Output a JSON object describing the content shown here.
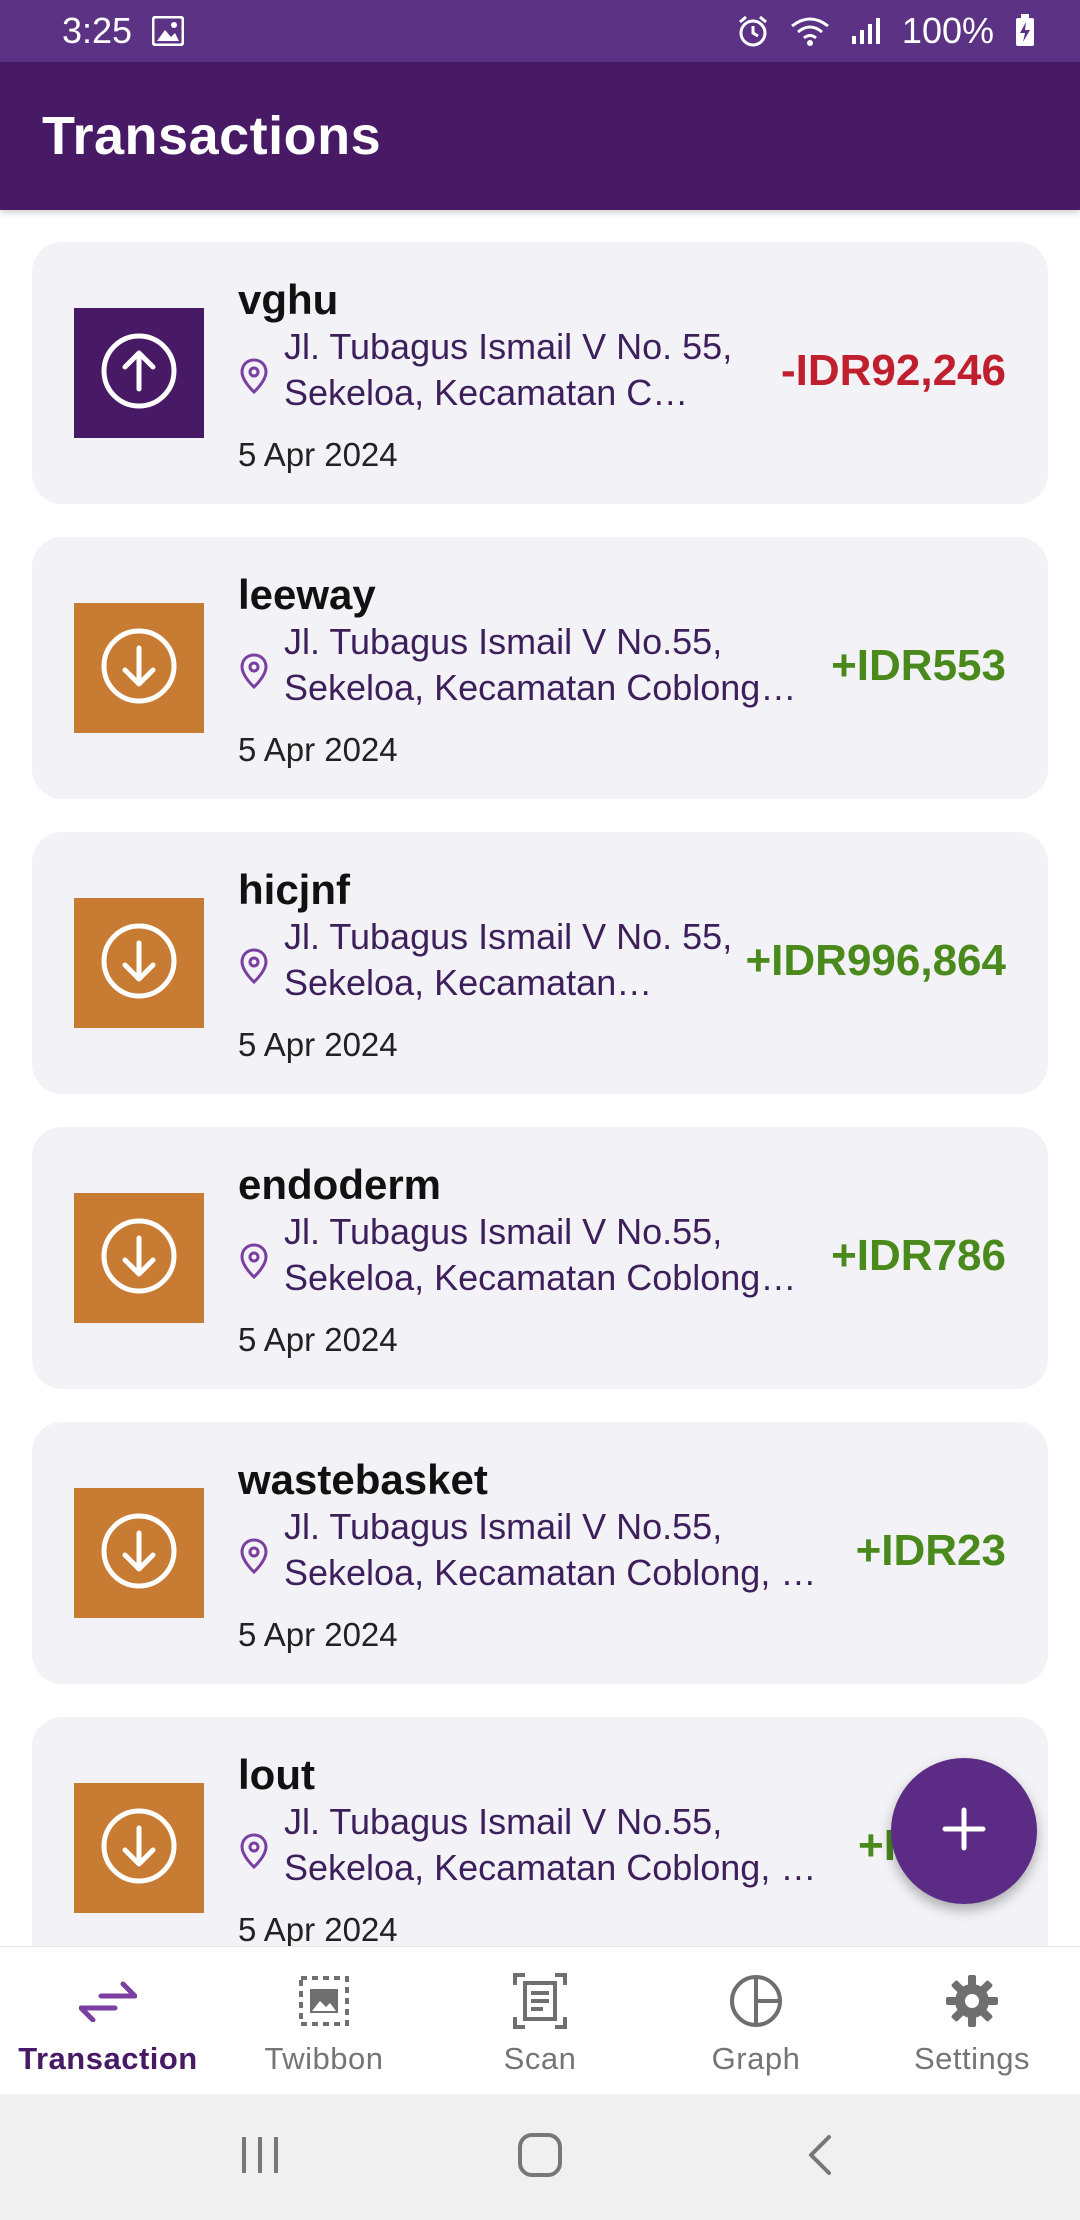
{
  "status_bar": {
    "time": "3:25",
    "battery": "100%"
  },
  "app_bar": {
    "title": "Transactions"
  },
  "transactions": [
    {
      "name": "vghu",
      "address": "Jl. Tubagus Ismail V No. 55, Sekeloa, Kecamatan C…",
      "date": "5 Apr 2024",
      "amount": "-IDR92,246",
      "type": "expense",
      "icon": "arrow-up-circle-icon"
    },
    {
      "name": "leeway",
      "address": "Jl. Tubagus Ismail V No.55, Sekeloa, Kecamatan Coblong…",
      "date": "5 Apr 2024",
      "amount": "+IDR553",
      "type": "income",
      "icon": "arrow-down-circle-icon"
    },
    {
      "name": "hicjnf",
      "address": "Jl. Tubagus Ismail V No. 55, Sekeloa, Kecamatan…",
      "date": "5 Apr 2024",
      "amount": "+IDR996,864",
      "type": "income",
      "icon": "arrow-down-circle-icon"
    },
    {
      "name": "endoderm",
      "address": "Jl. Tubagus Ismail V No.55, Sekeloa, Kecamatan Coblong…",
      "date": "5 Apr 2024",
      "amount": "+IDR786",
      "type": "income",
      "icon": "arrow-down-circle-icon"
    },
    {
      "name": "wastebasket",
      "address": "Jl. Tubagus Ismail V No.55, Sekeloa, Kecamatan Coblong, …",
      "date": "5 Apr 2024",
      "amount": "+IDR23",
      "type": "income",
      "icon": "arrow-down-circle-icon"
    },
    {
      "name": "lout",
      "address": "Jl. Tubagus Ismail V No.55, Sekeloa, Kecamatan Coblong, …",
      "date": "5 Apr 2024",
      "amount": "+I",
      "type": "income",
      "icon": "arrow-down-circle-icon"
    }
  ],
  "fab": {
    "icon": "plus-icon"
  },
  "bottom_nav": [
    {
      "label": "Transaction",
      "icon": "transfer-arrows-icon",
      "active": true
    },
    {
      "label": "Twibbon",
      "icon": "image-frame-icon",
      "active": false
    },
    {
      "label": "Scan",
      "icon": "scan-document-icon",
      "active": false
    },
    {
      "label": "Graph",
      "icon": "pie-chart-icon",
      "active": false
    },
    {
      "label": "Settings",
      "icon": "gear-icon",
      "active": false
    }
  ],
  "colors": {
    "app_bar": "#481a66",
    "status_bar": "#5b3284",
    "income_tile": "#c77b33",
    "expense_tile": "#481a66",
    "negative_amount": "#c0202e",
    "positive_amount": "#4a8a1d",
    "fab": "#5b2b86"
  }
}
